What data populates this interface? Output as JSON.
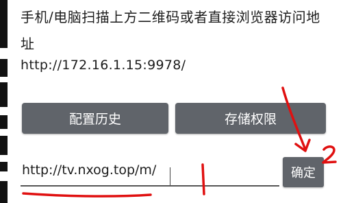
{
  "instruction": "手机/电脑扫描上方二维码或者直接浏览器访问地址",
  "address": "http://172.16.1.15:9978/",
  "buttons": {
    "history": "配置历史",
    "storage": "存储权限",
    "confirm": "确定"
  },
  "url_input": {
    "value": "http://tv.nxog.top/m/"
  },
  "annotations": {
    "mark_1": "1",
    "mark_2": "2",
    "color": "#e01010"
  },
  "colors": {
    "button_bg": "#60646a",
    "button_text": "#ffffff"
  }
}
